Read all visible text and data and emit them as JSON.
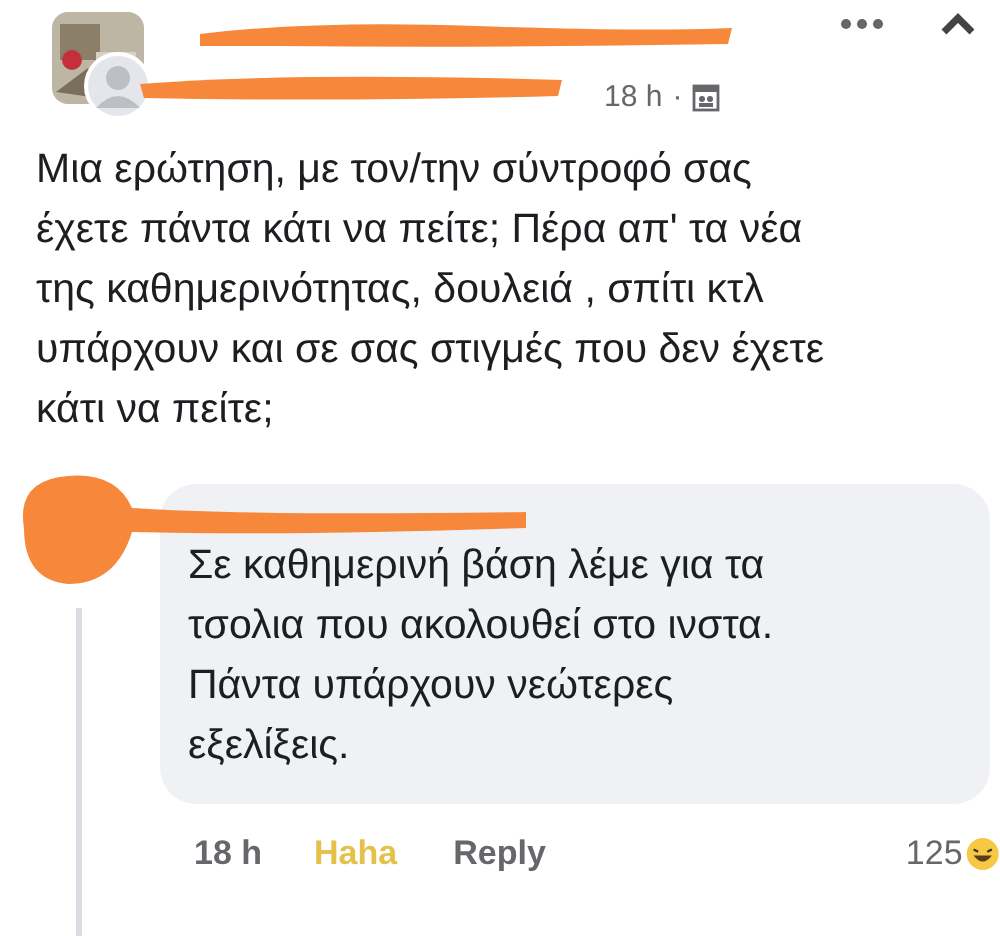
{
  "post": {
    "time": "18 h",
    "separator": "·",
    "text": "Μια ερώτηση, με τον/την σύντροφό σας\nέχετε πάντα κάτι να πείτε; Πέρα απ' τα νέα\nτης καθημερινότητας, δουλειά , σπίτι κτλ\nυπάρχουν και σε σας στιγμές που δεν έχετε\nκάτι να πείτε;"
  },
  "comment": {
    "text": "Σε καθημερινή βάση λέμε για τα\nτσολια που ακολουθεί στο ινστα.\nΠάντα υπάρχουν νεώτερες\nεξελίξεις.",
    "time": "18 h",
    "reaction": {
      "label": "Haha",
      "selected": true
    },
    "reply": "Reply",
    "count": "125"
  }
}
